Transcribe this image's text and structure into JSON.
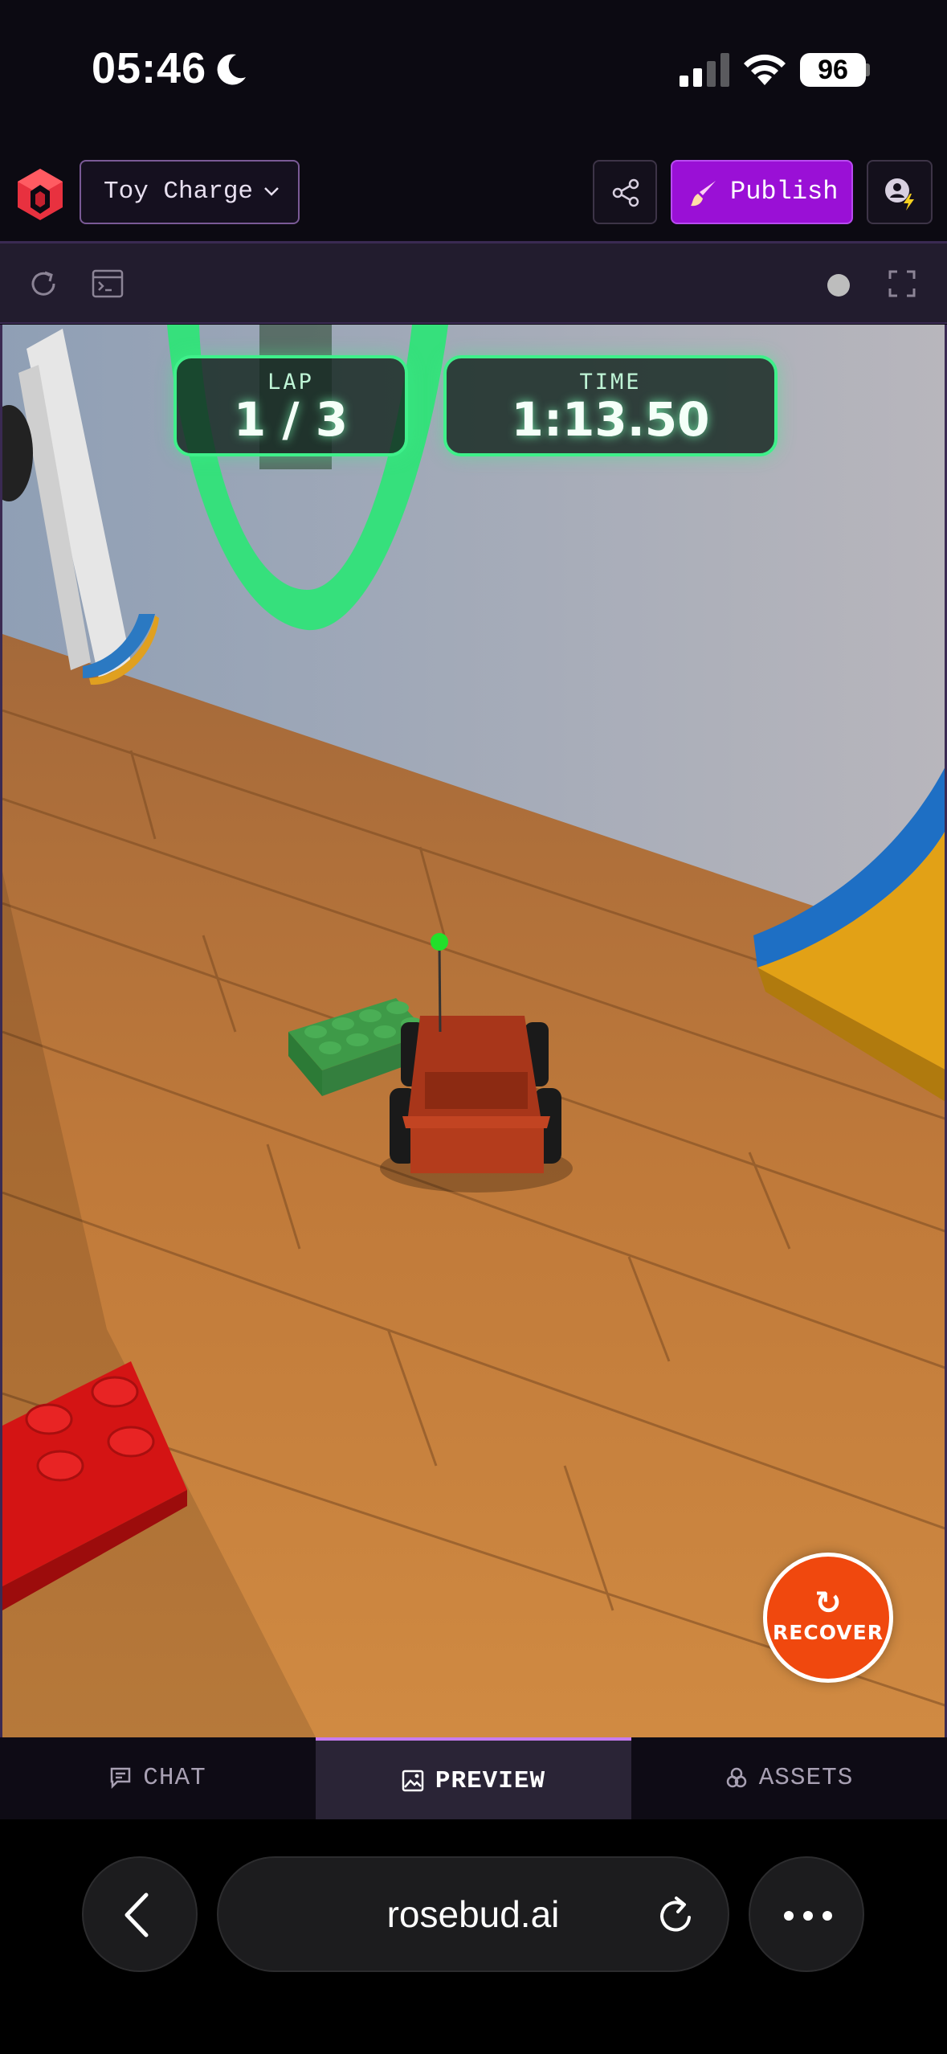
{
  "status_bar": {
    "time": "05:46",
    "battery": "96",
    "icons": [
      "moon-icon",
      "signal-icon",
      "wifi-icon",
      "battery-icon"
    ]
  },
  "header": {
    "project_name": "Toy Charge",
    "publish_label": "Publish",
    "icons": [
      "rosebud-logo",
      "chevron-down-icon",
      "share-icon",
      "brush-icon",
      "account-icon"
    ],
    "accent_color": "#9a10d6"
  },
  "toolbar": {
    "icons": [
      "reload-icon",
      "console-icon",
      "status-dot",
      "fullscreen-icon"
    ]
  },
  "game": {
    "hud": {
      "lap_label": "LAP",
      "lap_value": "1 / 3",
      "time_label": "TIME",
      "time_value": "1:13.50"
    },
    "recover_icon": "↻",
    "recover_label": "RECOVER",
    "hud_color": "#3ff08a"
  },
  "tabs": [
    {
      "label": "CHAT",
      "icon": "chat-icon",
      "active": false
    },
    {
      "label": "PREVIEW",
      "icon": "image-icon",
      "active": true
    },
    {
      "label": "ASSETS",
      "icon": "assets-icon",
      "active": false
    }
  ],
  "browser": {
    "url": "rosebud.ai",
    "icons": [
      "back-icon",
      "reload-icon",
      "more-icon"
    ]
  }
}
